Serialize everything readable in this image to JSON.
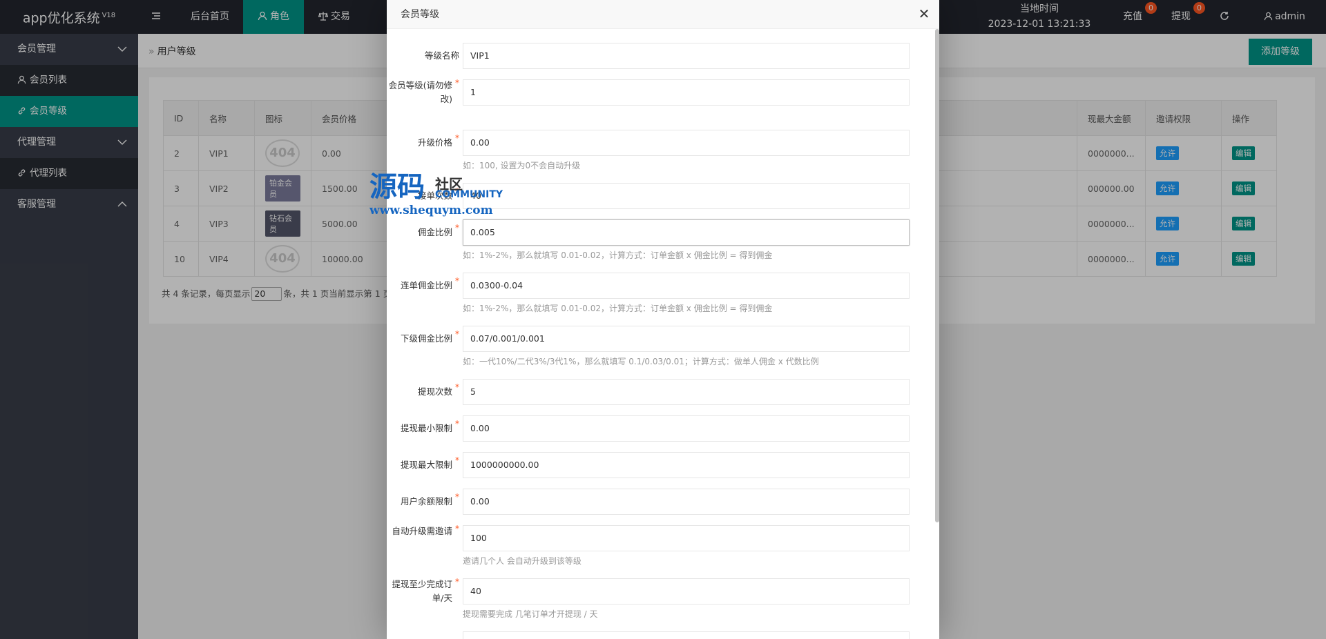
{
  "app": {
    "title": "app优化系统",
    "version": "V18"
  },
  "topnav": [
    {
      "label": "",
      "icon": "menu-toggle-icon"
    },
    {
      "label": "后台首页"
    },
    {
      "label": "角色",
      "icon": "user-icon"
    },
    {
      "label": "交易",
      "icon": "scale-icon"
    }
  ],
  "topright": {
    "time_label": "当地时间",
    "time_value": "2023-12-01 13:21:33",
    "recharge": "充值",
    "recharge_badge": "0",
    "withdraw": "提现",
    "withdraw_badge": "0",
    "user": "admin"
  },
  "sidebar": {
    "groups": [
      {
        "label": "会员管理",
        "items": [
          {
            "label": "会员列表"
          },
          {
            "label": "会员等级"
          }
        ]
      },
      {
        "label": "代理管理",
        "items": [
          {
            "label": "代理列表"
          }
        ]
      },
      {
        "label": "客服管理",
        "items": []
      }
    ]
  },
  "page": {
    "breadcrumb": "用户等级",
    "add_button": "添加等级"
  },
  "table": {
    "headers": [
      "ID",
      "名称",
      "图标",
      "会员价格",
      "现最大金额",
      "邀请权限",
      "操作"
    ],
    "rows": [
      {
        "id": "2",
        "name": "VIP1",
        "icon": "404",
        "price": "0.00",
        "max": "0000000...",
        "invite": "允许",
        "edit": "编辑"
      },
      {
        "id": "3",
        "name": "VIP2",
        "icon": "铂金会员",
        "price": "1500.00",
        "max": "000000.00",
        "invite": "允许",
        "edit": "编辑"
      },
      {
        "id": "4",
        "name": "VIP3",
        "icon": "钻石会员",
        "price": "5000.00",
        "max": "0000000...",
        "invite": "允许",
        "edit": "编辑"
      },
      {
        "id": "10",
        "name": "VIP4",
        "icon": "404",
        "price": "10000.00",
        "max": "0000000...",
        "invite": "允许",
        "edit": "编辑"
      }
    ],
    "pager": {
      "prefix": "共 4 条记录，每页显示",
      "size": "20",
      "suffix": "条，共 1 页当前显示第 1 页"
    }
  },
  "modal": {
    "title": "会员等级",
    "fields": [
      {
        "label": "等级名称",
        "value": "VIP1",
        "hint": ""
      },
      {
        "label": "会员等级(请勿修改)",
        "value": "1",
        "hint": ""
      },
      {
        "label": "升级价格",
        "value": "0.00",
        "hint": "如：100, 设置为0不会自动升级"
      },
      {
        "label": "接单次数",
        "value": "40",
        "hint": ""
      },
      {
        "label": "佣金比例",
        "value": "0.005",
        "hint": "如：1%-2%，那么就填写 0.01-0.02，计算方式：订单金额 x 佣金比例 = 得到佣金"
      },
      {
        "label": "连单佣金比例",
        "value": "0.0300-0.04",
        "hint": "如：1%-2%，那么就填写 0.01-0.02，计算方式：订单金额 x 佣金比例 = 得到佣金"
      },
      {
        "label": "下级佣金比例",
        "value": "0.07/0.001/0.001",
        "hint": "如：一代10%/二代3%/3代1%，那么就填写 0.1/0.03/0.01；计算方式：做单人佣金 x 代数比例"
      },
      {
        "label": "提现次数",
        "value": "5",
        "hint": ""
      },
      {
        "label": "提现最小限制",
        "value": "0.00",
        "hint": ""
      },
      {
        "label": "提现最大限制",
        "value": "1000000000.00",
        "hint": ""
      },
      {
        "label": "用户余额限制",
        "value": "0.00",
        "hint": ""
      },
      {
        "label": "自动升级需邀请",
        "value": "100",
        "hint": "邀请几个人 会自动升级到该等级"
      },
      {
        "label": "提现至少完成订单/天",
        "value": "40",
        "hint": "提现需要完成 几笔订单才开提现 / 天"
      }
    ]
  },
  "watermark": {
    "cn": "源码",
    "cn2": "社区",
    "en": "COMMUNITY",
    "url": "www.shequym.com"
  }
}
